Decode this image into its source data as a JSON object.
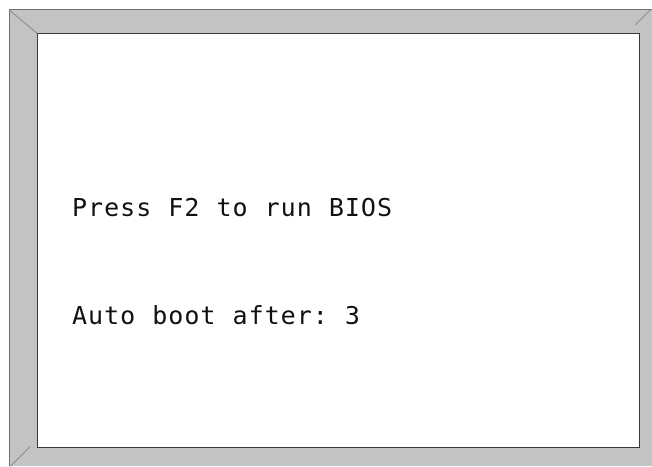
{
  "bios_screen": {
    "line1": "Press F2 to run BIOS",
    "line2": "Auto boot after: 3"
  },
  "colors": {
    "bezel": "#c3c3c3",
    "screen_background": "#ffffff",
    "text": "#111111",
    "outline": "#3a3a3a"
  }
}
